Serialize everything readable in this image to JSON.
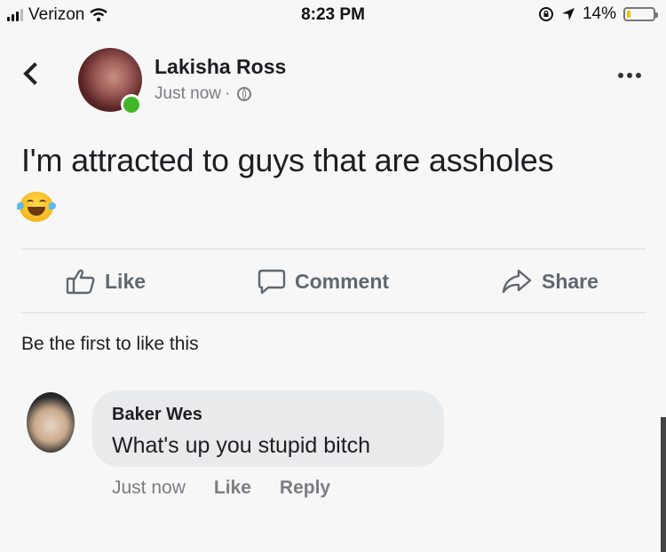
{
  "status_bar": {
    "carrier": "Verizon",
    "time": "8:23 PM",
    "battery_percent": "14%",
    "battery_level": 0.14,
    "battery_color": "#e9c400"
  },
  "post": {
    "author": "Lakisha Ross",
    "timestamp": "Just now",
    "separator": "·",
    "privacy_icon": "globe-icon",
    "text": "I'm attracted to guys that are assholes",
    "emoji": "face-with-tears-of-joy-icon",
    "online_color": "#42b72a"
  },
  "actions": {
    "like": "Like",
    "comment": "Comment",
    "share": "Share"
  },
  "reactions": {
    "summary": "Be the first to like this"
  },
  "comment": {
    "author": "Baker Wes",
    "text": "What's up you stupid bitch",
    "timestamp": "Just now",
    "like": "Like",
    "reply": "Reply"
  }
}
